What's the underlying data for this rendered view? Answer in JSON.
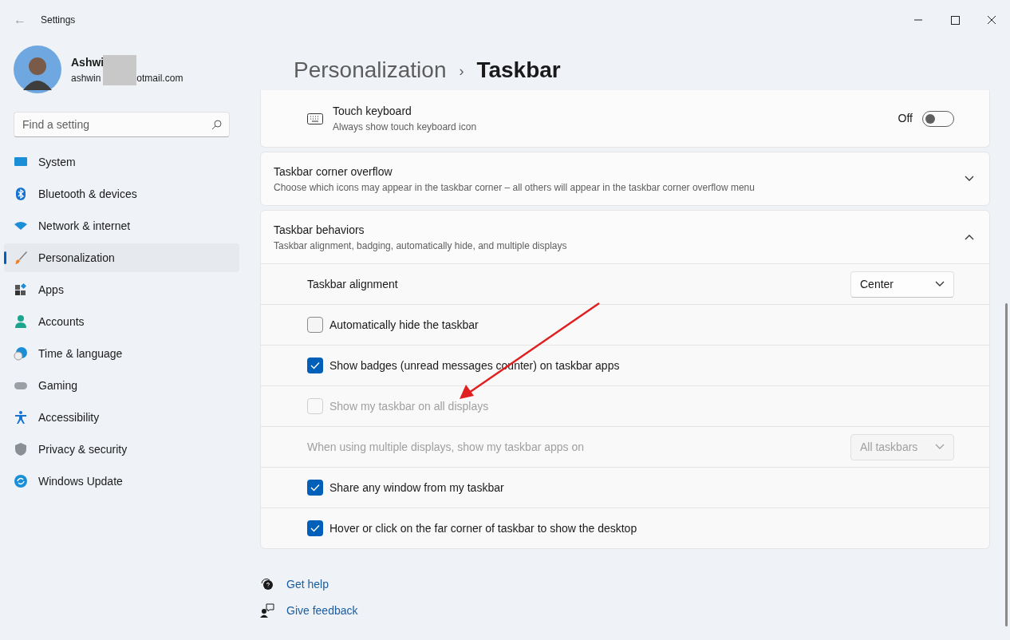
{
  "window": {
    "title": "Settings",
    "back": "←"
  },
  "account": {
    "name": "Ashwi",
    "email_start": "ashwin",
    "email_end": "otmail.com"
  },
  "search": {
    "placeholder": "Find a setting"
  },
  "sidebar": {
    "items": [
      {
        "label": "System",
        "selected": false
      },
      {
        "label": "Bluetooth & devices",
        "selected": false
      },
      {
        "label": "Network & internet",
        "selected": false
      },
      {
        "label": "Personalization",
        "selected": true
      },
      {
        "label": "Apps",
        "selected": false
      },
      {
        "label": "Accounts",
        "selected": false
      },
      {
        "label": "Time & language",
        "selected": false
      },
      {
        "label": "Gaming",
        "selected": false
      },
      {
        "label": "Accessibility",
        "selected": false
      },
      {
        "label": "Privacy & security",
        "selected": false
      },
      {
        "label": "Windows Update",
        "selected": false
      }
    ]
  },
  "breadcrumb": {
    "parent": "Personalization",
    "separator": "›",
    "current": "Taskbar"
  },
  "touch_keyboard": {
    "title": "Touch keyboard",
    "subtitle": "Always show touch keyboard icon",
    "state_label": "Off",
    "on": false
  },
  "corner_overflow": {
    "title": "Taskbar corner overflow",
    "subtitle": "Choose which icons may appear in the taskbar corner – all others will appear in the taskbar corner overflow menu",
    "expanded": false
  },
  "behaviors": {
    "title": "Taskbar behaviors",
    "subtitle": "Taskbar alignment, badging, automatically hide, and multiple displays",
    "expanded": true,
    "rows": [
      {
        "kind": "dropdown",
        "label": "Taskbar alignment",
        "value": "Center",
        "disabled": false
      },
      {
        "kind": "checkbox",
        "label": "Automatically hide the taskbar",
        "checked": false,
        "disabled": false
      },
      {
        "kind": "checkbox",
        "label": "Show badges (unread messages counter) on taskbar apps",
        "checked": true,
        "disabled": false
      },
      {
        "kind": "checkbox",
        "label": "Show my taskbar on all displays",
        "checked": false,
        "disabled": true
      },
      {
        "kind": "dropdown",
        "label": "When using multiple displays, show my taskbar apps on",
        "value": "All taskbars",
        "disabled": true
      },
      {
        "kind": "checkbox",
        "label": "Share any window from my taskbar",
        "checked": true,
        "disabled": false
      },
      {
        "kind": "checkbox",
        "label": "Hover or click on the far corner of taskbar to show the desktop",
        "checked": true,
        "disabled": false
      }
    ]
  },
  "links": [
    {
      "label": "Get help"
    },
    {
      "label": "Give feedback"
    }
  ]
}
